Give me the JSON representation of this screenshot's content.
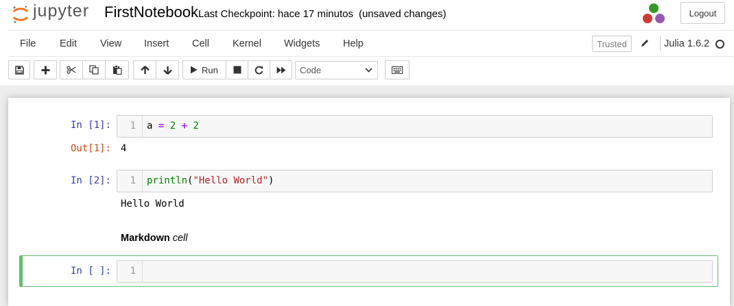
{
  "header": {
    "logo_text": "jupyter",
    "notebook_name": "FirstNotebook",
    "checkpoint_text": "Last Checkpoint: hace 17 minutos",
    "unsaved_text": "(unsaved changes)",
    "logout_label": "Logout"
  },
  "menubar": {
    "items": [
      "File",
      "Edit",
      "View",
      "Insert",
      "Cell",
      "Kernel",
      "Widgets",
      "Help"
    ],
    "trusted_label": "Trusted",
    "kernel_name": "Julia 1.6.2"
  },
  "toolbar": {
    "run_label": "Run",
    "cell_type_value": "Code",
    "icons": [
      "save-icon",
      "plus-icon",
      "cut-icon",
      "copy-icon",
      "paste-icon",
      "arrow-up-icon",
      "arrow-down-icon",
      "play-icon",
      "stop-icon",
      "restart-icon",
      "fast-forward-icon",
      "keyboard-icon"
    ]
  },
  "cells": [
    {
      "in_prompt": "In [1]:",
      "line_number": "1",
      "code_tokens": [
        "a",
        " ",
        "=",
        " ",
        "2",
        " ",
        "+",
        " ",
        "2"
      ],
      "out_prompt": "Out[1]:",
      "output": "4"
    },
    {
      "in_prompt": "In [2]:",
      "line_number": "1",
      "code_tokens": [
        "println",
        "(",
        "\"Hello World\"",
        ")"
      ],
      "output": "Hello World"
    },
    {
      "markdown_bold": "Markdown",
      "markdown_italic": "cell"
    },
    {
      "in_prompt": "In [ ]:",
      "line_number": "1"
    }
  ],
  "colors": {
    "in_prompt": "#303f9f",
    "out_prompt": "#d84315",
    "active_cell_border": "#66bb6a",
    "logo_orange": "#f37726"
  }
}
